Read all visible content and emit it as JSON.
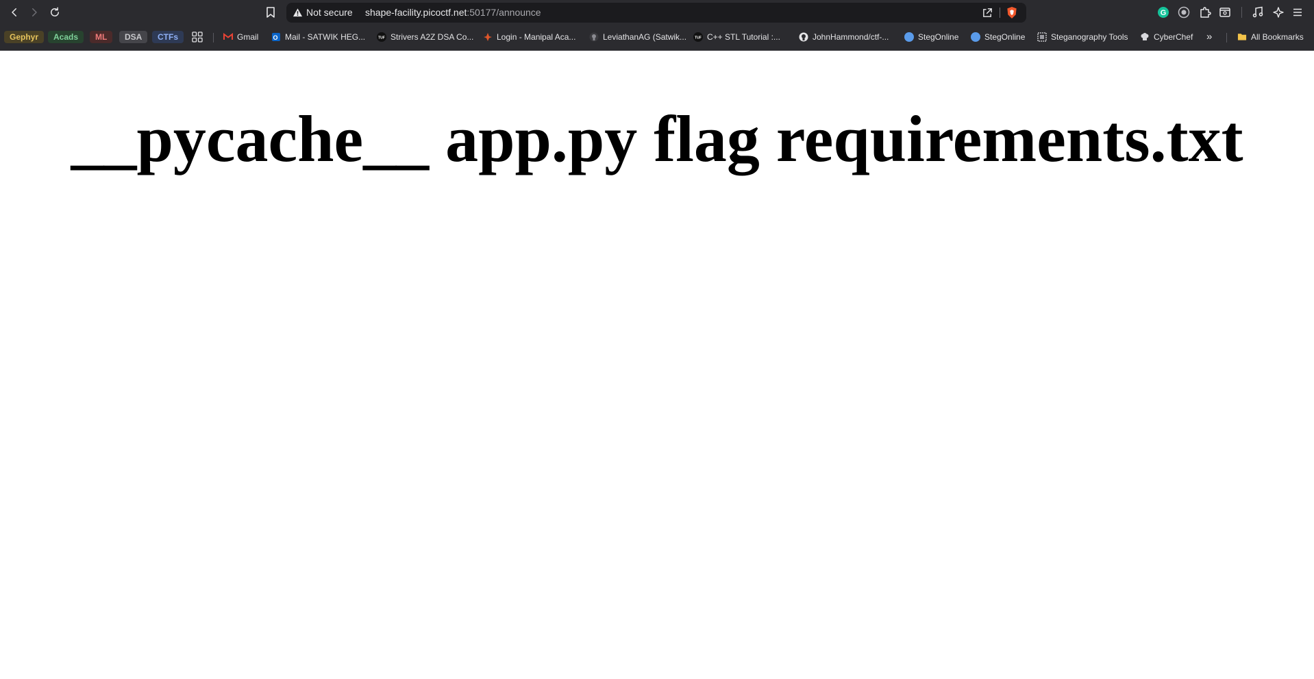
{
  "browser": {
    "security_label": "Not secure",
    "url_host": "shape-facility.picoctf.net",
    "url_path": ":50177/announce",
    "toolbar_icons": [
      "back-icon",
      "forward-icon",
      "reload-icon",
      "bookmark-page-icon",
      "share-icon",
      "brave-shields-icon",
      "grammarly-icon",
      "extension-circle-icon",
      "extensions-puzzle-icon",
      "tab-search-icon",
      "media-control-icon",
      "leo-ai-icon",
      "menu-icon"
    ]
  },
  "bookmarks_bar": {
    "groups": [
      {
        "label": "Gephyr",
        "color": "#e6c35c",
        "bg": "#4a4126"
      },
      {
        "label": "Acads",
        "color": "#7fd19a",
        "bg": "#27432f"
      },
      {
        "label": "ML",
        "color": "#f07a7a",
        "bg": "#4b2a2a"
      },
      {
        "label": "DSA",
        "color": "#c8c8cc",
        "bg": "#45454a"
      },
      {
        "label": "CTFs",
        "color": "#8fb0f5",
        "bg": "#2e3a55"
      }
    ],
    "items": [
      {
        "label": "Gmail",
        "icon": "gmail-icon"
      },
      {
        "label": "Mail - SATWIK HEG...",
        "icon": "outlook-icon"
      },
      {
        "label": "Strivers A2Z DSA Co...",
        "icon": "tuf-icon"
      },
      {
        "label": "Login - Manipal Aca...",
        "icon": "manipal-icon"
      },
      {
        "label": "LeviathanAG (Satwik...",
        "icon": "github-icon"
      },
      {
        "label": "C++ STL Tutorial :...",
        "icon": "tuf-icon"
      },
      {
        "label": "JohnHammond/ctf-...",
        "icon": "github-icon"
      },
      {
        "label": "StegOnline",
        "icon": "globe-icon"
      },
      {
        "label": "StegOnline",
        "icon": "globe-icon"
      },
      {
        "label": "Steganography Tools",
        "icon": "steg-tools-icon"
      },
      {
        "label": "CyberChef",
        "icon": "chef-hat-icon"
      }
    ],
    "overflow_label": "»",
    "all_bookmarks_label": "All Bookmarks"
  },
  "page": {
    "listing_text": "__pycache__ app.py flag requirements.txt"
  }
}
